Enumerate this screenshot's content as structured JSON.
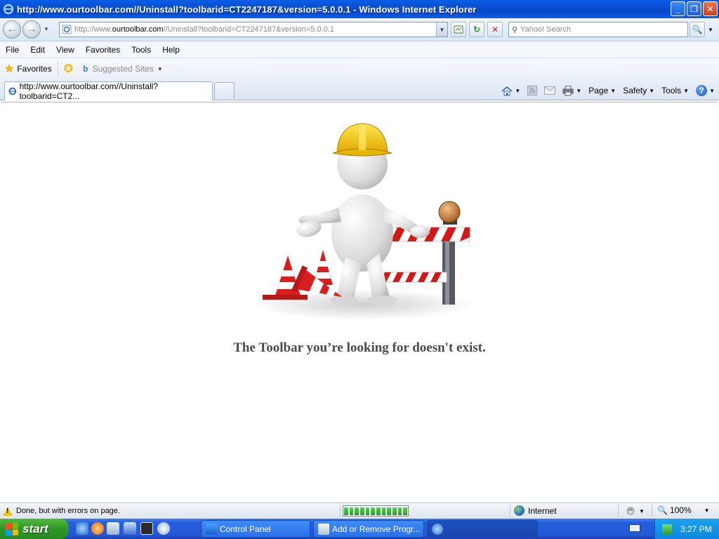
{
  "window": {
    "title": "http://www.ourtoolbar.com//Uninstall?toolbarid=CT2247187&version=5.0.0.1 - Windows Internet Explorer",
    "min_label": "_",
    "max_label": "❐",
    "close_label": "✕"
  },
  "address_bar": {
    "url_prefix": "http://www.",
    "url_host": "ourtoolbar.com",
    "url_rest": "//Uninstall?toolbarid=CT2247187&version=5.0.0.1",
    "search_placeholder": "Yahoo! Search"
  },
  "menu": [
    "File",
    "Edit",
    "View",
    "Favorites",
    "Tools",
    "Help"
  ],
  "favorites_bar": {
    "favorites_label": "Favorites",
    "suggested_sites_label": "Suggested Sites"
  },
  "tab": {
    "label": "http://www.ourtoolbar.com//Uninstall?toolbarid=CT2..."
  },
  "command_bar": {
    "page_label": "Page",
    "safety_label": "Safety",
    "tools_label": "Tools"
  },
  "content": {
    "message": "The Toolbar you’re looking for doesn't exist."
  },
  "status_bar": {
    "status_text": "Done, but with errors on page.",
    "progress_blocks": 12,
    "zone_label": "Internet",
    "zoom_label": "100%"
  },
  "taskbar": {
    "start_label": "start",
    "items": [
      {
        "label": "Control Panel"
      },
      {
        "label": "Add or Remove Progr..."
      }
    ],
    "clock": "3:27 PM"
  },
  "colors": {
    "titlebar": "#0a4fd1",
    "message_text": "#4a4a4a",
    "taskbar": "#245edb",
    "start_button": "#2f9526"
  }
}
